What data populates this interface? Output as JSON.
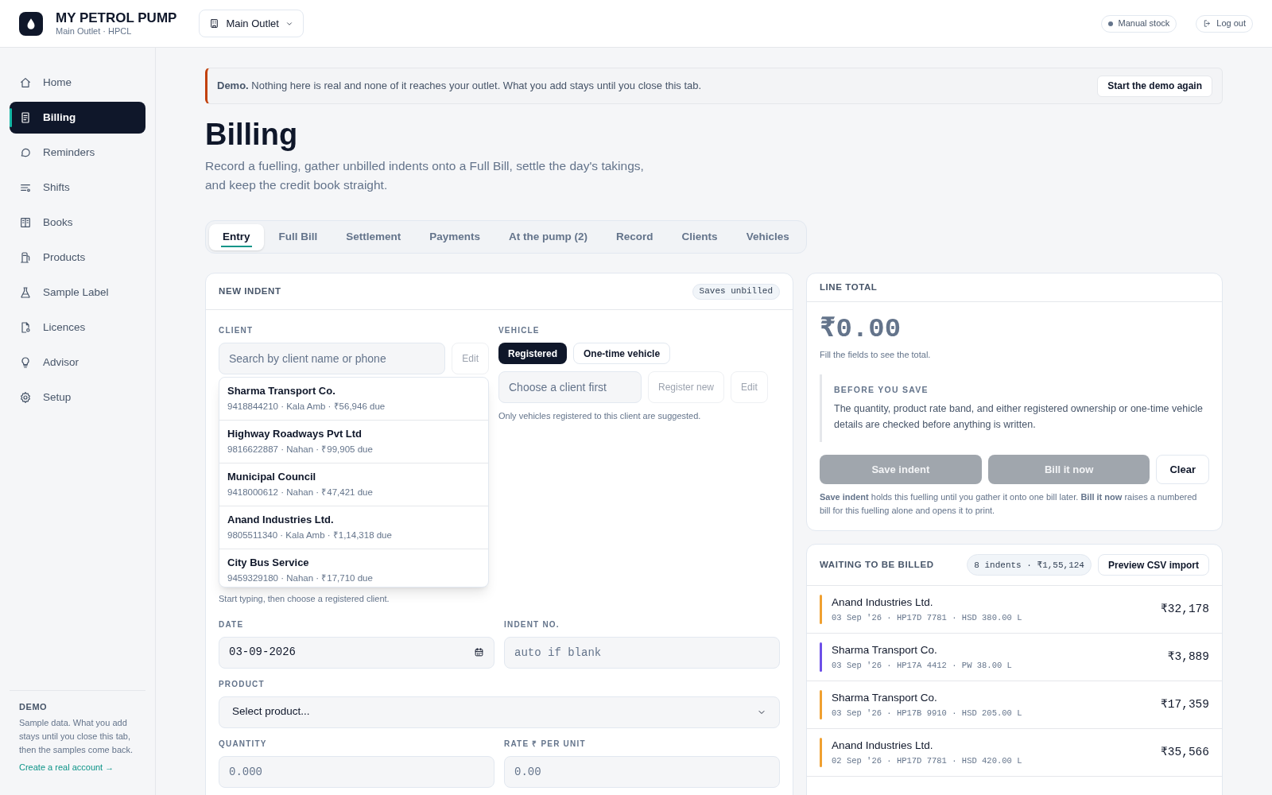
{
  "header": {
    "brand": {
      "title": "MY PETROL PUMP",
      "subtitle": "Main Outlet · HPCL"
    },
    "outlet_select": {
      "label": "Main Outlet"
    },
    "status_pill": {
      "label": "Manual stock"
    },
    "logout": {
      "label": "Log out"
    }
  },
  "sidebar": {
    "items": [
      {
        "label": "Home",
        "selected": false
      },
      {
        "label": "Billing",
        "selected": true
      },
      {
        "label": "Reminders",
        "selected": false
      },
      {
        "label": "Shifts",
        "selected": false
      },
      {
        "label": "Books",
        "selected": false
      },
      {
        "label": "Products",
        "selected": false
      },
      {
        "label": "Sample Label",
        "selected": false
      },
      {
        "label": "Licences",
        "selected": false
      },
      {
        "label": "Advisor",
        "selected": false
      },
      {
        "label": "Setup",
        "selected": false
      }
    ],
    "demo_note": {
      "heading": "DEMO",
      "text": "Sample data. What you add stays until you close this tab, then the samples come back.",
      "link": "Create a real account →"
    }
  },
  "banner": {
    "text": "**Demo.** Nothing here is real and none of it reaches your outlet. What you add stays until you close this tab.",
    "button": "Start the demo again"
  },
  "page": {
    "title": "Billing",
    "subtitle": "Record a fuelling, gather unbilled indents onto a Full Bill, settle the day's takings, and keep the credit book straight."
  },
  "tabs": [
    {
      "label": "Entry",
      "selected": true
    },
    {
      "label": "Full Bill",
      "selected": false
    },
    {
      "label": "Settlement",
      "selected": false
    },
    {
      "label": "Payments",
      "selected": false
    },
    {
      "label": "At the pump (2)",
      "selected": false
    },
    {
      "label": "Record",
      "selected": false
    },
    {
      "label": "Clients",
      "selected": false
    },
    {
      "label": "Vehicles",
      "selected": false
    }
  ],
  "new_indent": {
    "title": "NEW INDENT",
    "badge": "Saves unbilled",
    "client": {
      "label": "CLIENT",
      "placeholder": "Search by client name or phone",
      "edit_button": {
        "label": "Edit",
        "disabled": true
      },
      "suggestions": [
        {
          "name": "Sharma Transport Co.",
          "detail": "9418844210 · Kala Amb · ₹56,946 due"
        },
        {
          "name": "Highway Roadways Pvt Ltd",
          "detail": "9816622887 · Nahan · ₹99,905 due"
        },
        {
          "name": "Municipal Council",
          "detail": "9418000612 · Nahan · ₹47,421 due"
        },
        {
          "name": "Anand Industries Ltd.",
          "detail": "9805511340 · Kala Amb · ₹1,14,318 due"
        },
        {
          "name": "City Bus Service",
          "detail": "9459329180 · Nahan · ₹17,710 due"
        }
      ],
      "hint": "Start typing, then choose a registered client."
    },
    "vehicle": {
      "label": "VEHICLE",
      "modes": [
        {
          "label": "Registered",
          "selected": true
        },
        {
          "label": "One-time vehicle",
          "selected": false
        }
      ],
      "placeholder": "Choose a client first",
      "register_button": {
        "label": "Register new",
        "disabled": true
      },
      "edit_button": {
        "label": "Edit",
        "disabled": true
      },
      "hint": "Only vehicles registered to this client are suggested."
    },
    "date": {
      "label": "DATE",
      "value": "03-09-2026"
    },
    "indent_no": {
      "label": "INDENT NO.",
      "placeholder": "auto if blank"
    },
    "product": {
      "label": "PRODUCT",
      "value": "Select product..."
    },
    "quantity": {
      "label": "QUANTITY",
      "placeholder": "0.000"
    },
    "rate": {
      "label": "RATE ₹ PER UNIT",
      "placeholder": "0.00"
    }
  },
  "line_total": {
    "title": "LINE TOTAL",
    "amount": "₹0.00",
    "hint": "Fill the fields to see the total.",
    "note": {
      "heading": "BEFORE YOU SAVE",
      "text": "The quantity, product rate band, and either registered ownership or one-time vehicle details are checked before anything is written."
    },
    "buttons": [
      {
        "kind": "primary",
        "label": "Save indent",
        "disabled": true
      },
      {
        "kind": "primary",
        "label": "Bill it now",
        "disabled": true
      },
      {
        "kind": "secondary",
        "label": "Clear",
        "disabled": false
      }
    ],
    "footnote": "**Save indent** holds this fuelling until you gather it onto one bill later. **Bill it now** raises a numbered bill for this fuelling alone and opens it to print."
  },
  "waiting": {
    "title": "WAITING TO BE BILLED",
    "summary": "8 indents · ₹1,55,124",
    "button": "Preview CSV import",
    "rows": [
      {
        "name": "Anand Industries Ltd.",
        "detail": "03 Sep '26 · HP17D 7781 · HSD 380.00 L",
        "amount": "₹32,178",
        "color": "#f0a030"
      },
      {
        "name": "Sharma Transport Co.",
        "detail": "03 Sep '26 · HP17A 4412 · PW 38.00 L",
        "amount": "₹3,889",
        "color": "#6d4fe8"
      },
      {
        "name": "Sharma Transport Co.",
        "detail": "03 Sep '26 · HP17B 9910 · HSD 205.00 L",
        "amount": "₹17,359",
        "color": "#f0a030"
      },
      {
        "name": "Anand Industries Ltd.",
        "detail": "02 Sep '26 · HP17D 7781 · HSD 420.00 L",
        "amount": "₹35,566",
        "color": "#f0a030"
      }
    ]
  }
}
